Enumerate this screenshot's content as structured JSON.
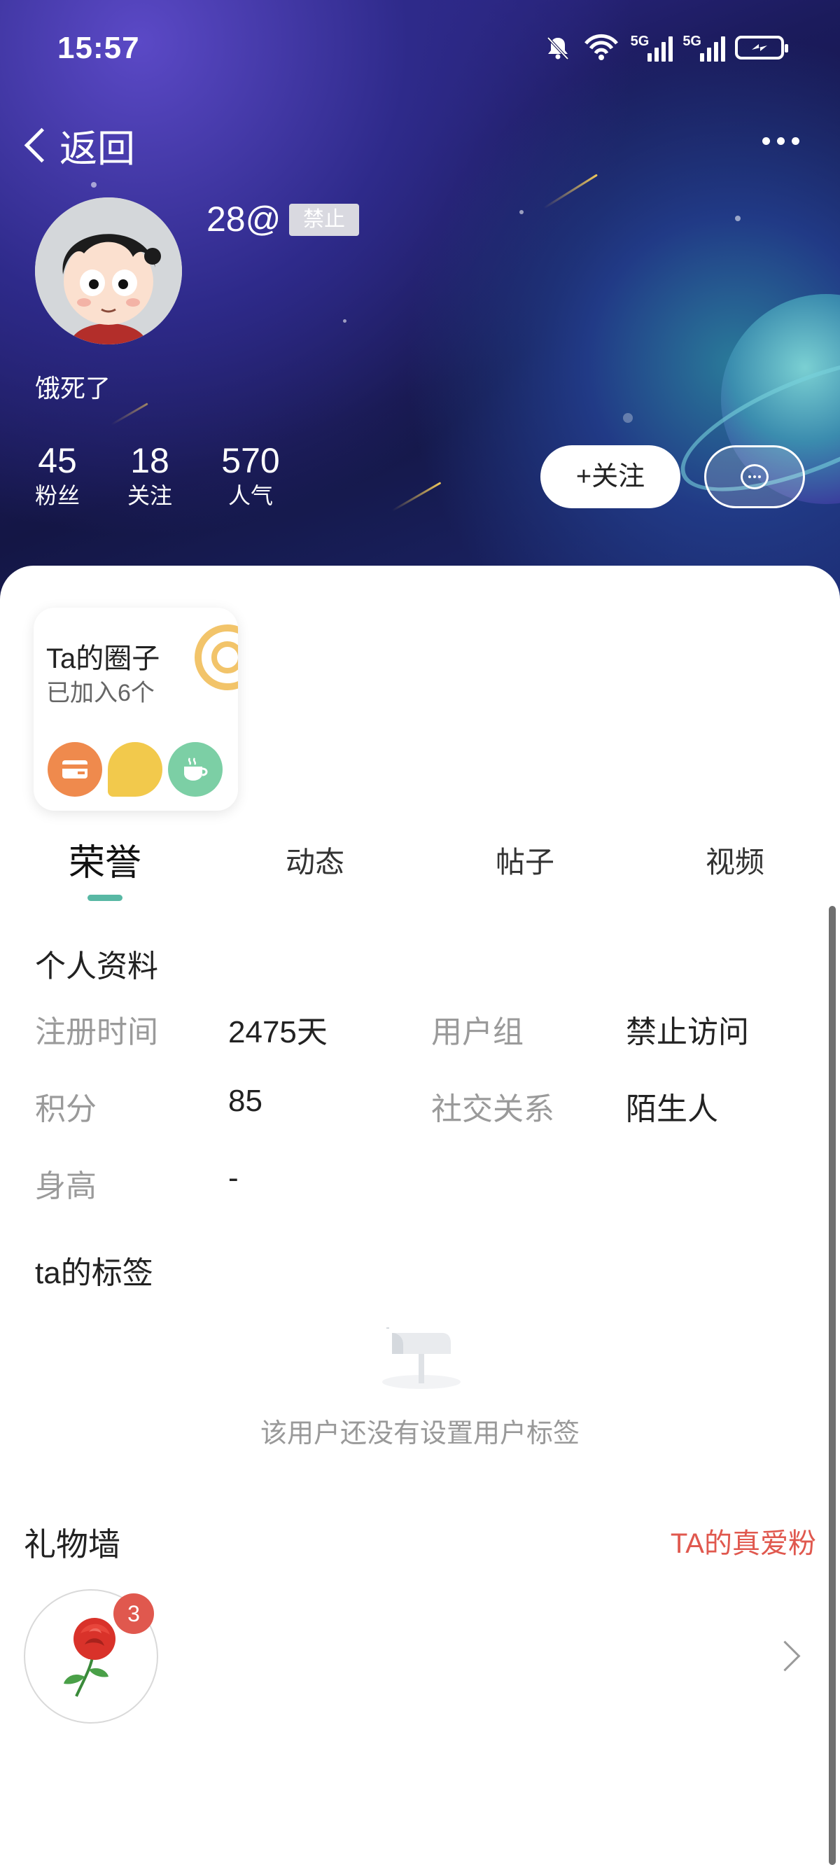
{
  "status_bar": {
    "time": "15:57",
    "network_5g_1": "5G",
    "network_5g_2": "5G"
  },
  "nav": {
    "back_label": "返回"
  },
  "profile": {
    "nickname": "28@",
    "ban_badge": "禁止",
    "signature": "饿死了",
    "stats": [
      {
        "value": "45",
        "label": "粉丝"
      },
      {
        "value": "18",
        "label": "关注"
      },
      {
        "value": "570",
        "label": "人气"
      }
    ],
    "follow_label": "+关注"
  },
  "circle_card": {
    "title": "Ta的圈子",
    "subtitle": "已加入6个"
  },
  "tabs": [
    {
      "label": "荣誉",
      "active": true
    },
    {
      "label": "动态",
      "active": false
    },
    {
      "label": "帖子",
      "active": false
    },
    {
      "label": "视频",
      "active": false
    }
  ],
  "personal_info": {
    "title": "个人资料",
    "fields": {
      "reg_time_label": "注册时间",
      "reg_time_value": "2475天",
      "user_group_label": "用户组",
      "user_group_value": "禁止访问",
      "points_label": "积分",
      "points_value": "85",
      "relation_label": "社交关系",
      "relation_value": "陌生人",
      "height_label": "身高",
      "height_value": "-"
    }
  },
  "tags": {
    "title": "ta的标签",
    "empty_text": "该用户还没有设置用户标签"
  },
  "gift_wall": {
    "title": "礼物墙",
    "link_label": "TA的真爱粉",
    "gift_count": "3",
    "gift_icon": "rose-icon"
  },
  "colors": {
    "accent": "#58b8a4",
    "gift_red": "#e0584e",
    "circle_gold": "#f2c46a"
  }
}
